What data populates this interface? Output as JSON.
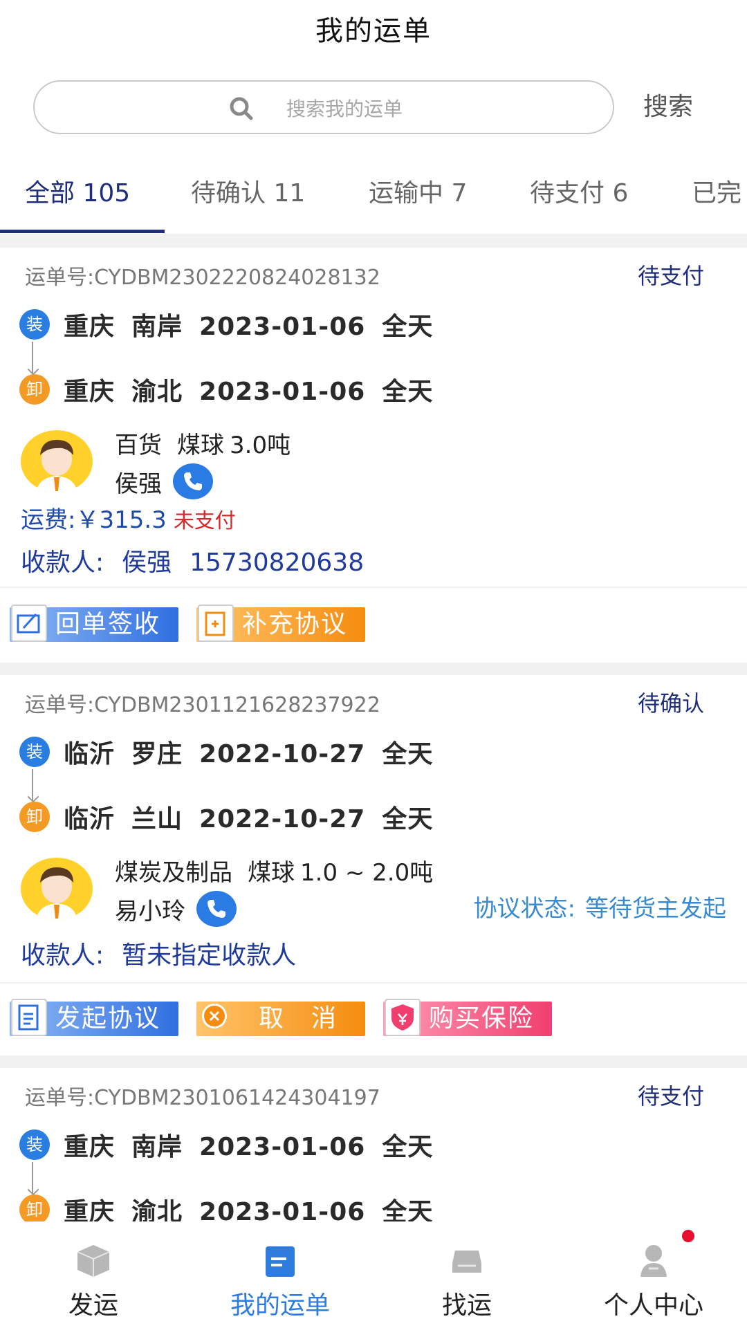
{
  "header": {
    "title": "我的运单"
  },
  "search": {
    "placeholder": "搜索我的运单",
    "value": "",
    "button_label": "搜索"
  },
  "tabs": [
    {
      "label": "全部 105",
      "active": true
    },
    {
      "label": "待确认 11",
      "active": false
    },
    {
      "label": "运输中 7",
      "active": false
    },
    {
      "label": "待支付 6",
      "active": false
    },
    {
      "label": "已完",
      "active": false
    }
  ],
  "orders": [
    {
      "order_no": "运单号:CYDBM2302220824028132",
      "status": "待支付",
      "load": {
        "badge": "装",
        "city": "重庆",
        "district": "南岸",
        "date": "2023-01-06",
        "time": "全天"
      },
      "unload": {
        "badge": "卸",
        "city": "重庆",
        "district": "渝北",
        "date": "2023-01-06",
        "time": "全天"
      },
      "goods": {
        "category": "百货",
        "name": "煤球",
        "amount": "3.0吨"
      },
      "contact": "侯强",
      "fee": {
        "label": "运费:",
        "amount": "￥315.3",
        "status": "未支付"
      },
      "payee": {
        "label": "收款人:",
        "name": "侯强",
        "phone": "15730820638"
      },
      "actions": [
        {
          "label": "回单签收",
          "style": "blue",
          "icon": "receipt-sign-icon"
        },
        {
          "label": "补充协议",
          "style": "orange",
          "icon": "supplement-agreement-icon"
        }
      ]
    },
    {
      "order_no": "运单号:CYDBM2301121628237922",
      "status": "待确认",
      "load": {
        "badge": "装",
        "city": "临沂",
        "district": "罗庄",
        "date": "2022-10-27",
        "time": "全天"
      },
      "unload": {
        "badge": "卸",
        "city": "临沂",
        "district": "兰山",
        "date": "2022-10-27",
        "time": "全天"
      },
      "goods": {
        "category": "煤炭及制品",
        "name": "煤球",
        "amount": "1.0 ~ 2.0吨"
      },
      "contact": "易小玲",
      "agreement": {
        "label": "协议状态:",
        "value": "等待货主发起"
      },
      "payee": {
        "label": "收款人:",
        "name": "暂未指定收款人"
      },
      "actions": [
        {
          "label": "发起协议",
          "style": "blue",
          "icon": "document-icon"
        },
        {
          "label": "取　消",
          "style": "orange",
          "icon": "cancel-icon"
        },
        {
          "label": "购买保险",
          "style": "pink",
          "icon": "insurance-icon"
        }
      ]
    },
    {
      "order_no": "运单号:CYDBM2301061424304197",
      "status": "待支付",
      "load": {
        "badge": "装",
        "city": "重庆",
        "district": "南岸",
        "date": "2023-01-06",
        "time": "全天"
      },
      "unload": {
        "badge": "卸",
        "city": "重庆",
        "district": "渝北",
        "date": "2023-01-06",
        "time": "全天"
      }
    }
  ],
  "tabbar": [
    {
      "label": "发运",
      "icon": "box-icon",
      "active": false
    },
    {
      "label": "我的运单",
      "icon": "waybill-icon",
      "active": true
    },
    {
      "label": "找运",
      "icon": "truck-icon",
      "active": false
    },
    {
      "label": "个人中心",
      "icon": "profile-icon",
      "active": false,
      "has_notification": true
    }
  ],
  "colors": {
    "accent": "#1f2e7a",
    "active_nav": "#2e7be0",
    "unpaid": "#d62a2a",
    "notification": "#e8102e"
  }
}
